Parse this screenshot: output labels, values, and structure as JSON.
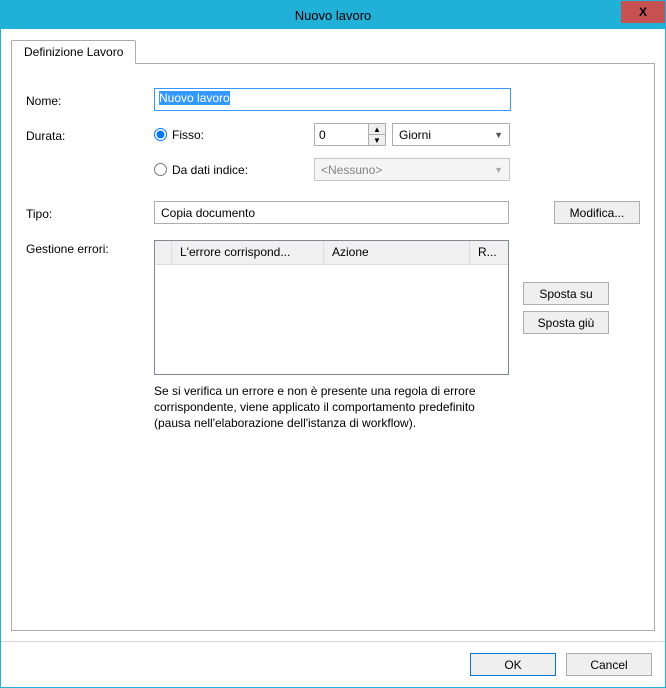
{
  "window": {
    "title": "Nuovo lavoro",
    "close": "X"
  },
  "tabs": {
    "def": "Definizione Lavoro"
  },
  "labels": {
    "name": "Nome:",
    "duration": "Durata:",
    "type": "Tipo:",
    "error_handling": "Gestione errori:"
  },
  "name_field": {
    "value": "Nuovo lavoro"
  },
  "duration": {
    "fixed_label": "Fisso:",
    "fixed_value": "0",
    "unit_selected": "Giorni",
    "from_index_label": "Da dati indice:",
    "from_index_value": "<Nessuno>"
  },
  "type_field": {
    "value": "Copia documento",
    "modify_btn": "Modifica..."
  },
  "error_grid": {
    "col_match": "L'errore corrispond...",
    "col_action": "Azione",
    "col_r": "R..."
  },
  "buttons": {
    "move_up": "Sposta su",
    "move_down": "Sposta giù",
    "ok": "OK",
    "cancel": "Cancel"
  },
  "help": "Se si verifica un errore e non è presente una regola di errore corrispondente, viene applicato il comportamento predefinito (pausa nell'elaborazione dell'istanza di workflow)."
}
